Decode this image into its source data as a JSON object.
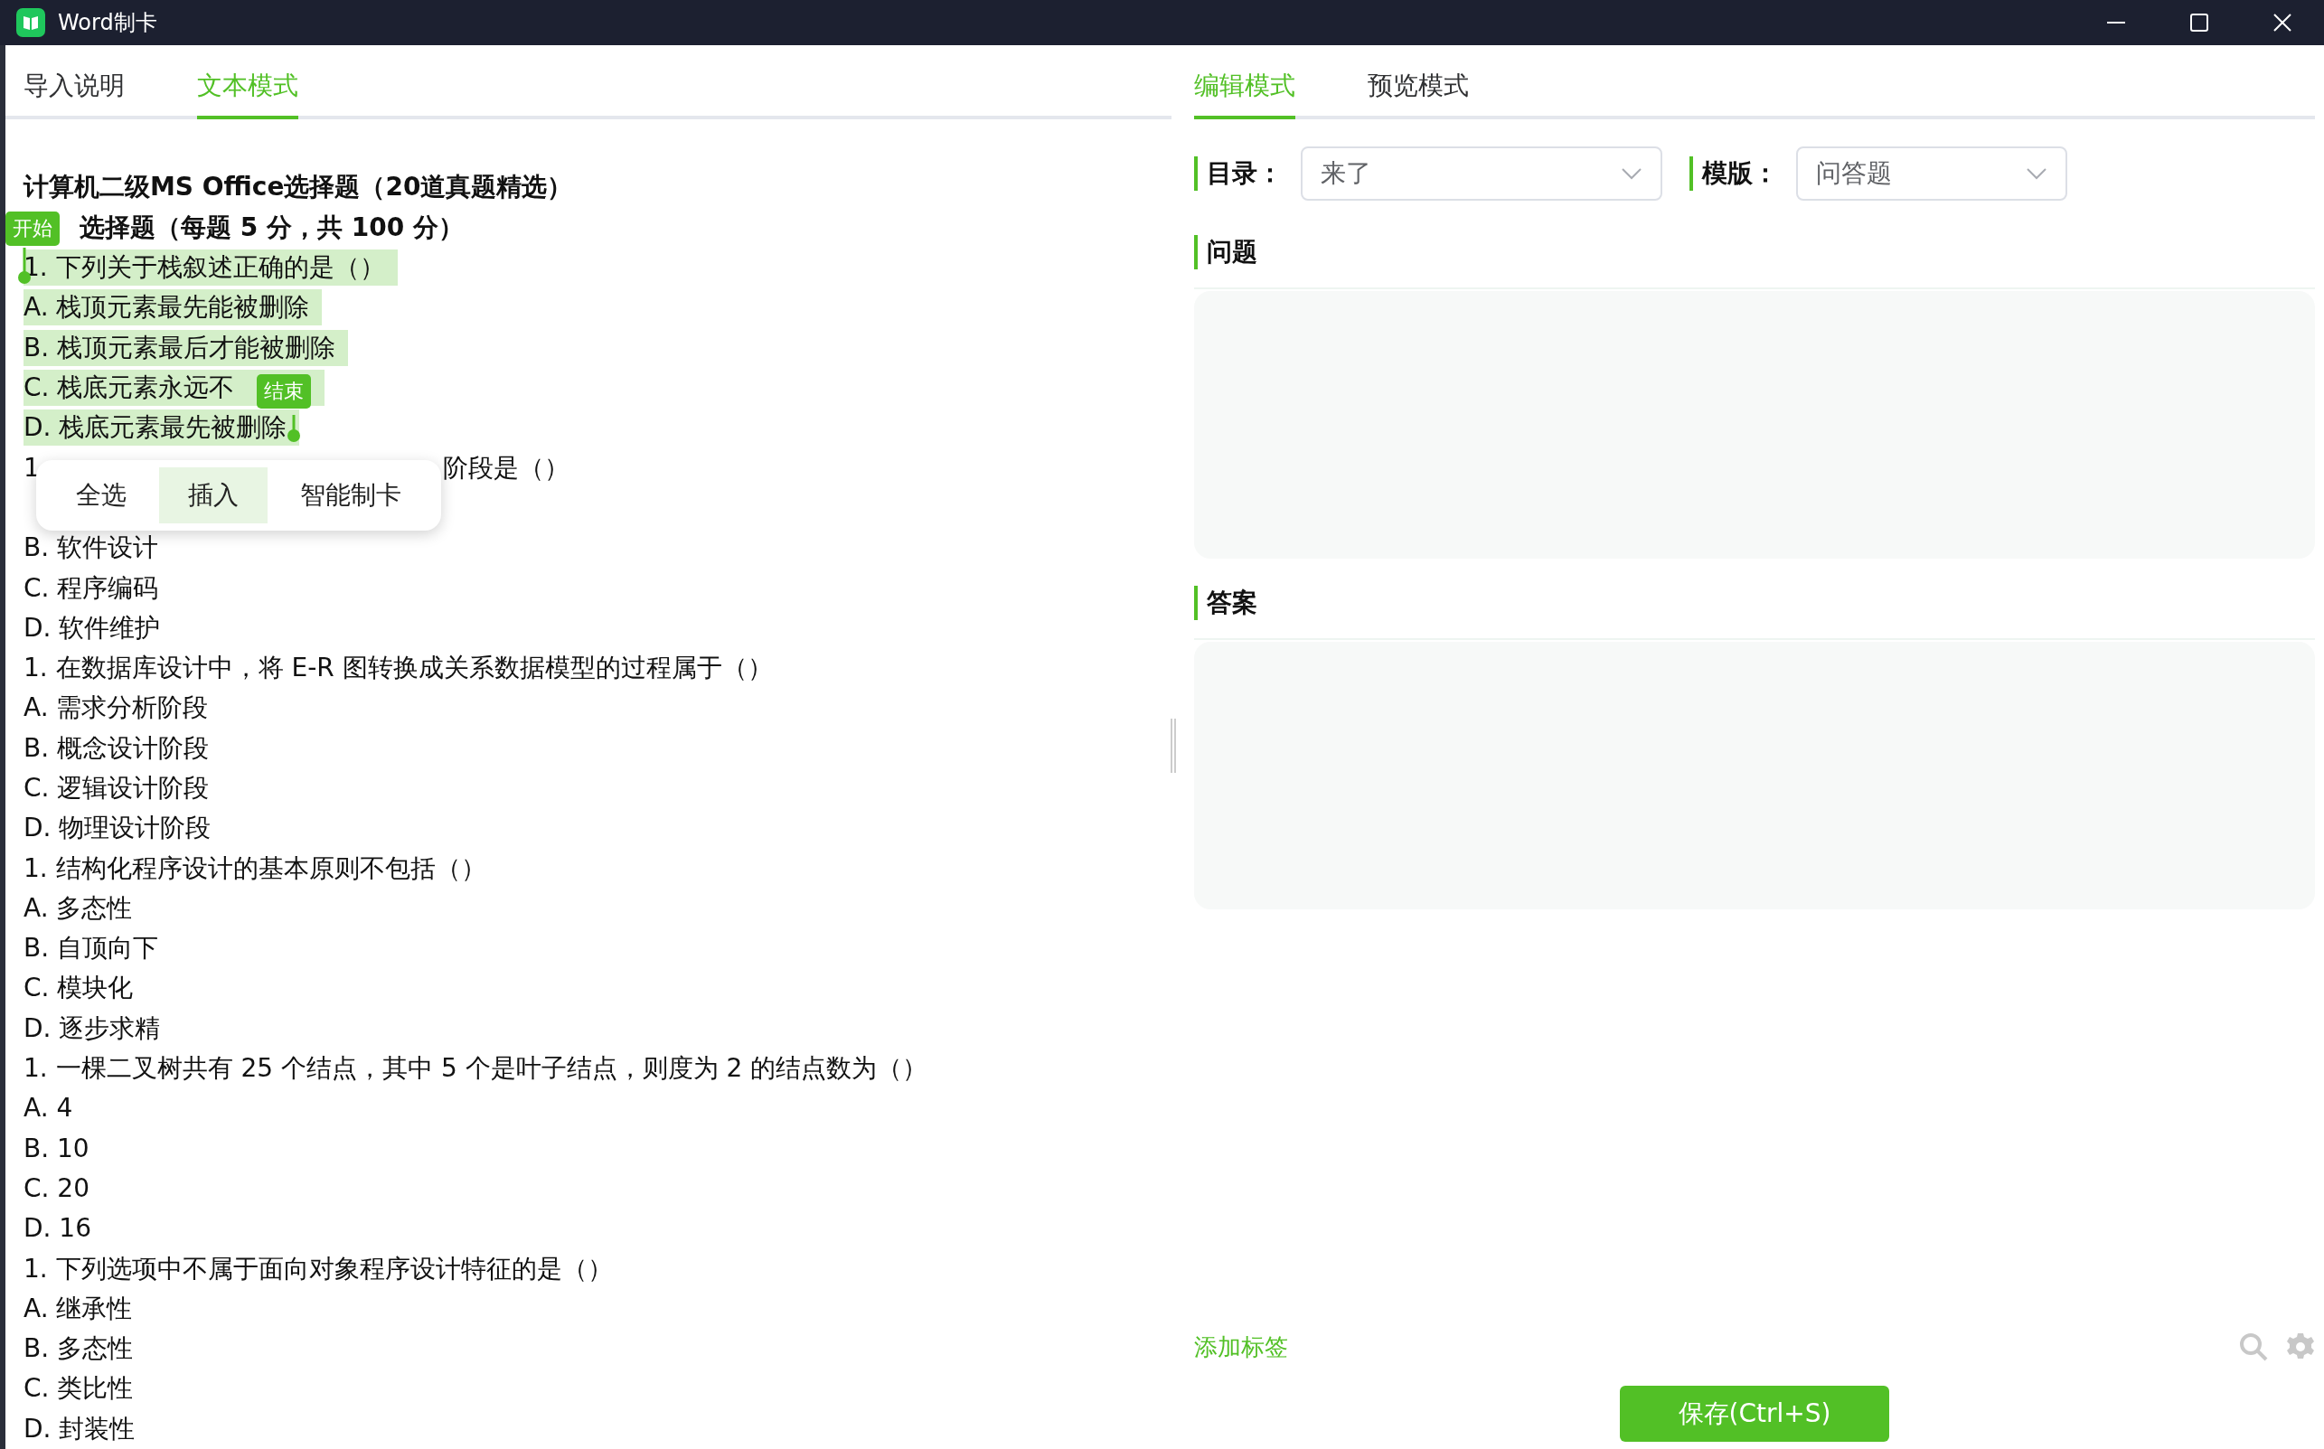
{
  "window": {
    "title": "Word制卡"
  },
  "left_tabs": [
    {
      "label": "导入说明",
      "selected": false
    },
    {
      "label": "文本模式",
      "selected": true
    }
  ],
  "document": {
    "title": "计算机二级MS Office选择题（20道真题精选）",
    "section": "选择题（每题 5 分，共 100 分）",
    "start_marker": "开始",
    "end_marker": "结束",
    "lines": [
      {
        "kind": "line",
        "text": "1. 下列关于栈叙述正确的是（）",
        "highlighted": true,
        "selection_start": true
      },
      {
        "kind": "line",
        "text": "A. 栈顶元素最先能被删除",
        "highlighted": true
      },
      {
        "kind": "line",
        "text": "B. 栈顶元素最后才能被删除",
        "highlighted": true
      },
      {
        "kind": "covered",
        "text_start": "C. 栈底元素永远不",
        "highlighted": true,
        "end_tag": true
      },
      {
        "kind": "line",
        "text": "D. 栈底元素最先被删除",
        "highlighted": true,
        "selection_end": true
      },
      {
        "kind": "covered",
        "text_start": "1",
        "text_end": "阶段是（）",
        "highlighted": false,
        "popup": true
      },
      {
        "kind": "hidden"
      },
      {
        "kind": "line",
        "text": "B. 软件设计",
        "highlighted": false
      },
      {
        "kind": "line",
        "text": "C. 程序编码",
        "highlighted": false
      },
      {
        "kind": "line",
        "text": "D. 软件维护",
        "highlighted": false
      },
      {
        "kind": "line",
        "text": "1. 在数据库设计中，将 E-R 图转换成关系数据模型的过程属于（）",
        "highlighted": false
      },
      {
        "kind": "line",
        "text": "A. 需求分析阶段",
        "highlighted": false
      },
      {
        "kind": "line",
        "text": "B. 概念设计阶段",
        "highlighted": false
      },
      {
        "kind": "line",
        "text": "C. 逻辑设计阶段",
        "highlighted": false
      },
      {
        "kind": "line",
        "text": "D. 物理设计阶段",
        "highlighted": false
      },
      {
        "kind": "line",
        "text": "1. 结构化程序设计的基本原则不包括（）",
        "highlighted": false
      },
      {
        "kind": "line",
        "text": "A. 多态性",
        "highlighted": false
      },
      {
        "kind": "line",
        "text": "B. 自顶向下",
        "highlighted": false
      },
      {
        "kind": "line",
        "text": "C. 模块化",
        "highlighted": false
      },
      {
        "kind": "line",
        "text": "D. 逐步求精",
        "highlighted": false
      },
      {
        "kind": "line",
        "text": "1. 一棵二叉树共有 25 个结点，其中 5 个是叶子结点，则度为 2 的结点数为（）",
        "highlighted": false
      },
      {
        "kind": "line",
        "text": "A. 4",
        "highlighted": false
      },
      {
        "kind": "line",
        "text": "B. 10",
        "highlighted": false
      },
      {
        "kind": "line",
        "text": "C. 20",
        "highlighted": false
      },
      {
        "kind": "line",
        "text": "D. 16",
        "highlighted": false
      },
      {
        "kind": "line",
        "text": "1. 下列选项中不属于面向对象程序设计特征的是（）",
        "highlighted": false
      },
      {
        "kind": "line",
        "text": "A. 继承性",
        "highlighted": false
      },
      {
        "kind": "line",
        "text": "B. 多态性",
        "highlighted": false
      },
      {
        "kind": "line",
        "text": "C. 类比性",
        "highlighted": false
      },
      {
        "kind": "line",
        "text": "D. 封装性",
        "highlighted": false
      }
    ]
  },
  "popup_menu": [
    {
      "label": "全选",
      "selected": false
    },
    {
      "label": "插入",
      "selected": true
    },
    {
      "label": "智能制卡",
      "selected": false
    }
  ],
  "right_tabs": [
    {
      "label": "编辑模式",
      "selected": true
    },
    {
      "label": "预览模式",
      "selected": false
    }
  ],
  "catalog": {
    "label": "目录：",
    "value": "来了"
  },
  "template": {
    "label": "模版：",
    "value": "问答题"
  },
  "question": {
    "label": "问题"
  },
  "answer": {
    "label": "答案"
  },
  "add_tag": "添加标签",
  "save_button": "保存(Ctrl+S)"
}
